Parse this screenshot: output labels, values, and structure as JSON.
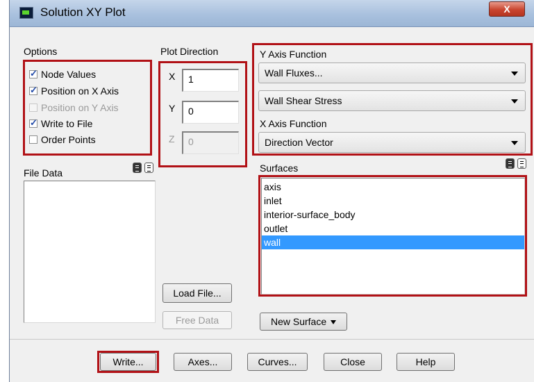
{
  "window": {
    "title": "Solution XY Plot",
    "close_label": "X"
  },
  "options": {
    "label": "Options",
    "items": [
      {
        "label": "Node Values",
        "checked": true,
        "enabled": true
      },
      {
        "label": "Position on X Axis",
        "checked": true,
        "enabled": true
      },
      {
        "label": "Position on Y Axis",
        "checked": false,
        "enabled": false
      },
      {
        "label": "Write to File",
        "checked": true,
        "enabled": true
      },
      {
        "label": "Order Points",
        "checked": false,
        "enabled": true
      }
    ]
  },
  "plot_direction": {
    "label": "Plot Direction",
    "x_label": "X",
    "x_value": "1",
    "y_label": "Y",
    "y_value": "0",
    "z_label": "Z",
    "z_value": "0"
  },
  "y_axis_function": {
    "label": "Y Axis Function",
    "category": "Wall Fluxes...",
    "quantity": "Wall Shear Stress"
  },
  "x_axis_function": {
    "label": "X Axis Function",
    "value": "Direction Vector"
  },
  "file_data": {
    "label": "File Data"
  },
  "surfaces": {
    "label": "Surfaces",
    "items": [
      "axis",
      "inlet",
      "interior-surface_body",
      "outlet",
      "wall"
    ],
    "selected": "wall"
  },
  "buttons": {
    "load_file": "Load File...",
    "free_data": "Free Data",
    "new_surface": "New Surface",
    "write": "Write...",
    "axes": "Axes...",
    "curves": "Curves...",
    "close": "Close",
    "help": "Help"
  },
  "colors": {
    "highlight_border": "#b11116",
    "selection": "#3399ff"
  }
}
